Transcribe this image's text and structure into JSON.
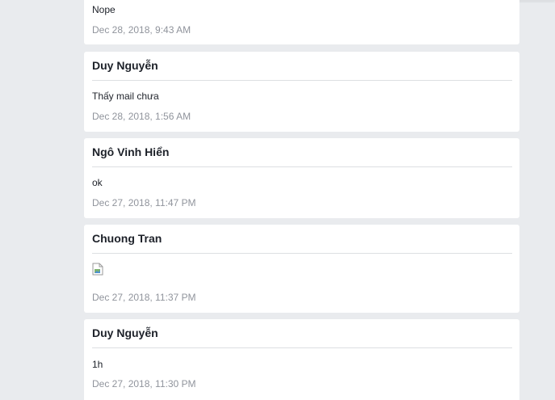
{
  "posts": [
    {
      "author": "",
      "message": "Nope",
      "timestamp": "Dec 28, 2018, 9:43 AM"
    },
    {
      "author": "Duy Nguyễn",
      "message": "Thấy mail chưa",
      "timestamp": "Dec 28, 2018, 1:56 AM"
    },
    {
      "author": "Ngô Vinh Hiển",
      "message": "ok",
      "timestamp": "Dec 27, 2018, 11:47 PM"
    },
    {
      "author": "Chuong Tran",
      "message": "",
      "attachment_icon": "broken-image-icon",
      "timestamp": "Dec 27, 2018, 11:37 PM"
    },
    {
      "author": "Duy Nguyễn",
      "message": "1h",
      "timestamp": "Dec 27, 2018, 11:30 PM"
    }
  ]
}
